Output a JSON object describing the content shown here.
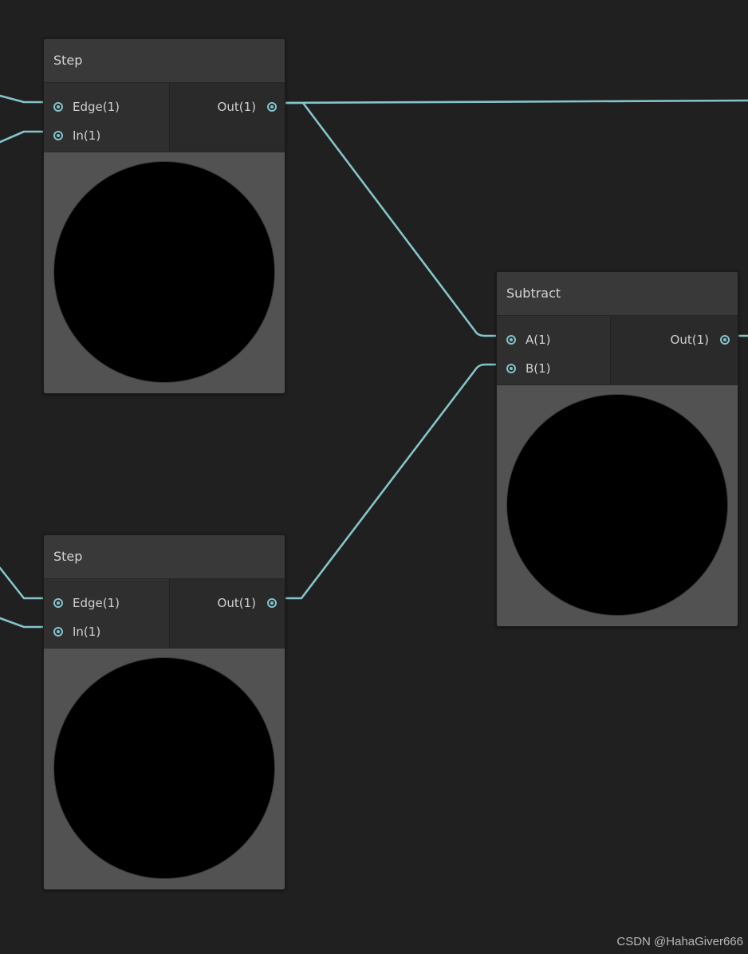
{
  "nodes": {
    "step_top": {
      "title": "Step",
      "inputs": [
        "Edge(1)",
        "In(1)"
      ],
      "output": "Out(1)"
    },
    "step_bottom": {
      "title": "Step",
      "inputs": [
        "Edge(1)",
        "In(1)"
      ],
      "output": "Out(1)"
    },
    "subtract": {
      "title": "Subtract",
      "inputs": [
        "A(1)",
        "B(1)"
      ],
      "output": "Out(1)"
    }
  },
  "colors": {
    "canvas": "#202020",
    "wire": "#84c4ca",
    "preview_bg": "#525252",
    "preview_ball": "#000000"
  },
  "watermark": "CSDN @HahaGiver666"
}
